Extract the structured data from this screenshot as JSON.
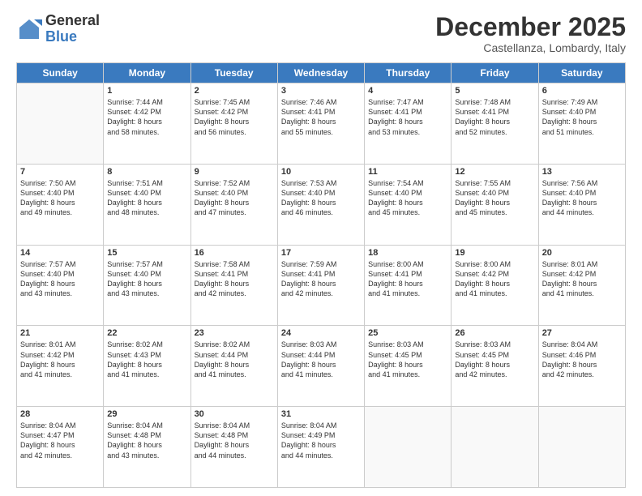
{
  "logo": {
    "general": "General",
    "blue": "Blue"
  },
  "title": "December 2025",
  "subtitle": "Castellanza, Lombardy, Italy",
  "headers": [
    "Sunday",
    "Monday",
    "Tuesday",
    "Wednesday",
    "Thursday",
    "Friday",
    "Saturday"
  ],
  "weeks": [
    [
      {
        "day": "",
        "sunrise": "",
        "sunset": "",
        "daylight": ""
      },
      {
        "day": "1",
        "sunrise": "Sunrise: 7:44 AM",
        "sunset": "Sunset: 4:42 PM",
        "daylight": "Daylight: 8 hours and 58 minutes."
      },
      {
        "day": "2",
        "sunrise": "Sunrise: 7:45 AM",
        "sunset": "Sunset: 4:42 PM",
        "daylight": "Daylight: 8 hours and 56 minutes."
      },
      {
        "day": "3",
        "sunrise": "Sunrise: 7:46 AM",
        "sunset": "Sunset: 4:41 PM",
        "daylight": "Daylight: 8 hours and 55 minutes."
      },
      {
        "day": "4",
        "sunrise": "Sunrise: 7:47 AM",
        "sunset": "Sunset: 4:41 PM",
        "daylight": "Daylight: 8 hours and 53 minutes."
      },
      {
        "day": "5",
        "sunrise": "Sunrise: 7:48 AM",
        "sunset": "Sunset: 4:41 PM",
        "daylight": "Daylight: 8 hours and 52 minutes."
      },
      {
        "day": "6",
        "sunrise": "Sunrise: 7:49 AM",
        "sunset": "Sunset: 4:40 PM",
        "daylight": "Daylight: 8 hours and 51 minutes."
      }
    ],
    [
      {
        "day": "7",
        "sunrise": "Sunrise: 7:50 AM",
        "sunset": "Sunset: 4:40 PM",
        "daylight": "Daylight: 8 hours and 49 minutes."
      },
      {
        "day": "8",
        "sunrise": "Sunrise: 7:51 AM",
        "sunset": "Sunset: 4:40 PM",
        "daylight": "Daylight: 8 hours and 48 minutes."
      },
      {
        "day": "9",
        "sunrise": "Sunrise: 7:52 AM",
        "sunset": "Sunset: 4:40 PM",
        "daylight": "Daylight: 8 hours and 47 minutes."
      },
      {
        "day": "10",
        "sunrise": "Sunrise: 7:53 AM",
        "sunset": "Sunset: 4:40 PM",
        "daylight": "Daylight: 8 hours and 46 minutes."
      },
      {
        "day": "11",
        "sunrise": "Sunrise: 7:54 AM",
        "sunset": "Sunset: 4:40 PM",
        "daylight": "Daylight: 8 hours and 45 minutes."
      },
      {
        "day": "12",
        "sunrise": "Sunrise: 7:55 AM",
        "sunset": "Sunset: 4:40 PM",
        "daylight": "Daylight: 8 hours and 45 minutes."
      },
      {
        "day": "13",
        "sunrise": "Sunrise: 7:56 AM",
        "sunset": "Sunset: 4:40 PM",
        "daylight": "Daylight: 8 hours and 44 minutes."
      }
    ],
    [
      {
        "day": "14",
        "sunrise": "Sunrise: 7:57 AM",
        "sunset": "Sunset: 4:40 PM",
        "daylight": "Daylight: 8 hours and 43 minutes."
      },
      {
        "day": "15",
        "sunrise": "Sunrise: 7:57 AM",
        "sunset": "Sunset: 4:40 PM",
        "daylight": "Daylight: 8 hours and 43 minutes."
      },
      {
        "day": "16",
        "sunrise": "Sunrise: 7:58 AM",
        "sunset": "Sunset: 4:41 PM",
        "daylight": "Daylight: 8 hours and 42 minutes."
      },
      {
        "day": "17",
        "sunrise": "Sunrise: 7:59 AM",
        "sunset": "Sunset: 4:41 PM",
        "daylight": "Daylight: 8 hours and 42 minutes."
      },
      {
        "day": "18",
        "sunrise": "Sunrise: 8:00 AM",
        "sunset": "Sunset: 4:41 PM",
        "daylight": "Daylight: 8 hours and 41 minutes."
      },
      {
        "day": "19",
        "sunrise": "Sunrise: 8:00 AM",
        "sunset": "Sunset: 4:42 PM",
        "daylight": "Daylight: 8 hours and 41 minutes."
      },
      {
        "day": "20",
        "sunrise": "Sunrise: 8:01 AM",
        "sunset": "Sunset: 4:42 PM",
        "daylight": "Daylight: 8 hours and 41 minutes."
      }
    ],
    [
      {
        "day": "21",
        "sunrise": "Sunrise: 8:01 AM",
        "sunset": "Sunset: 4:42 PM",
        "daylight": "Daylight: 8 hours and 41 minutes."
      },
      {
        "day": "22",
        "sunrise": "Sunrise: 8:02 AM",
        "sunset": "Sunset: 4:43 PM",
        "daylight": "Daylight: 8 hours and 41 minutes."
      },
      {
        "day": "23",
        "sunrise": "Sunrise: 8:02 AM",
        "sunset": "Sunset: 4:44 PM",
        "daylight": "Daylight: 8 hours and 41 minutes."
      },
      {
        "day": "24",
        "sunrise": "Sunrise: 8:03 AM",
        "sunset": "Sunset: 4:44 PM",
        "daylight": "Daylight: 8 hours and 41 minutes."
      },
      {
        "day": "25",
        "sunrise": "Sunrise: 8:03 AM",
        "sunset": "Sunset: 4:45 PM",
        "daylight": "Daylight: 8 hours and 41 minutes."
      },
      {
        "day": "26",
        "sunrise": "Sunrise: 8:03 AM",
        "sunset": "Sunset: 4:45 PM",
        "daylight": "Daylight: 8 hours and 42 minutes."
      },
      {
        "day": "27",
        "sunrise": "Sunrise: 8:04 AM",
        "sunset": "Sunset: 4:46 PM",
        "daylight": "Daylight: 8 hours and 42 minutes."
      }
    ],
    [
      {
        "day": "28",
        "sunrise": "Sunrise: 8:04 AM",
        "sunset": "Sunset: 4:47 PM",
        "daylight": "Daylight: 8 hours and 42 minutes."
      },
      {
        "day": "29",
        "sunrise": "Sunrise: 8:04 AM",
        "sunset": "Sunset: 4:48 PM",
        "daylight": "Daylight: 8 hours and 43 minutes."
      },
      {
        "day": "30",
        "sunrise": "Sunrise: 8:04 AM",
        "sunset": "Sunset: 4:48 PM",
        "daylight": "Daylight: 8 hours and 44 minutes."
      },
      {
        "day": "31",
        "sunrise": "Sunrise: 8:04 AM",
        "sunset": "Sunset: 4:49 PM",
        "daylight": "Daylight: 8 hours and 44 minutes."
      },
      {
        "day": "",
        "sunrise": "",
        "sunset": "",
        "daylight": ""
      },
      {
        "day": "",
        "sunrise": "",
        "sunset": "",
        "daylight": ""
      },
      {
        "day": "",
        "sunrise": "",
        "sunset": "",
        "daylight": ""
      }
    ]
  ]
}
